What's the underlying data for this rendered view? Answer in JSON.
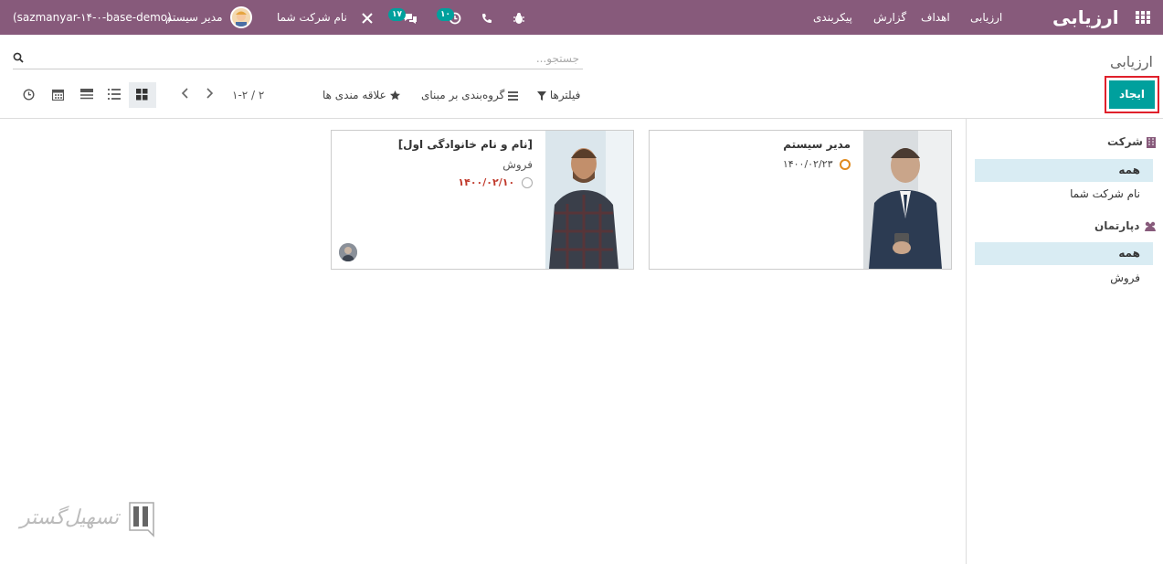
{
  "navbar": {
    "brand": "ارزیابی",
    "menu": [
      "ارزیابی",
      "اهداف",
      "گزارش",
      "پیکربندی"
    ],
    "activity_count": "۱۰",
    "chat_count": "۱۷",
    "company": "نام شرکت شما",
    "user": "مدیر سیستم",
    "db": "(sazmanyar-۱۴-۰-base-demo)",
    "icons": [
      "apps-icon",
      "bug-icon",
      "phone-icon",
      "clock-icon",
      "chat-icon",
      "tools-icon"
    ]
  },
  "control": {
    "breadcrumb": "ارزیابی",
    "search_placeholder": "جستجو...",
    "create": "ایجاد",
    "filters": "فیلترها",
    "groupby": "گروه‌بندی بر مبنای",
    "favorites": "علاقه مندی ها",
    "pager": "۱-۲ / ۲"
  },
  "sidebar": {
    "company_title": "شرکت",
    "company_items": [
      "همه",
      "نام شرکت شما"
    ],
    "dept_title": "دپارتمان",
    "dept_items": [
      "همه",
      "فروش"
    ]
  },
  "cards": [
    {
      "name": "مدیر سیستم",
      "dept": "",
      "date": "۱۴۰۰/۰۲/۲۳",
      "date_state": "warning"
    },
    {
      "name": "[نام و نام خانوادگی اول]",
      "dept": "فروش",
      "date": "۱۴۰۰/۰۲/۱۰",
      "date_state": "overdue"
    }
  ],
  "colors": {
    "primary": "#875A7B",
    "accent": "#00A09D",
    "overdue": "#c0392b",
    "warning": "#e08a1e"
  },
  "watermark": "تسهیل‌گستر"
}
